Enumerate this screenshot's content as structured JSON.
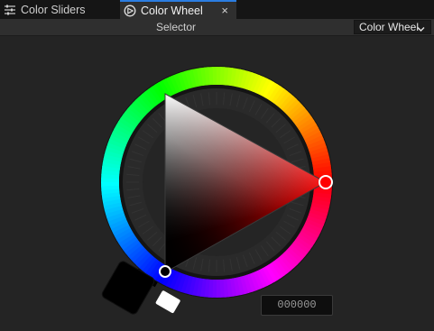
{
  "tabs": [
    {
      "label": "Color Sliders",
      "icon": "sliders-icon",
      "active": false
    },
    {
      "label": "Color Wheel",
      "icon": "color-wheel-icon",
      "active": true
    }
  ],
  "tab_close_glyph": "×",
  "toolbar": {
    "title": "Selector",
    "mode": "Color Wheel"
  },
  "picker": {
    "hex": "000000",
    "hue_degrees": 0,
    "saturation": 0,
    "value": 0,
    "current_color": "#000000",
    "previous_color": "#ffffff"
  },
  "colors": {
    "background": "#242424",
    "tab_active": "#2f2f2f",
    "accent": "#2b7de1"
  }
}
